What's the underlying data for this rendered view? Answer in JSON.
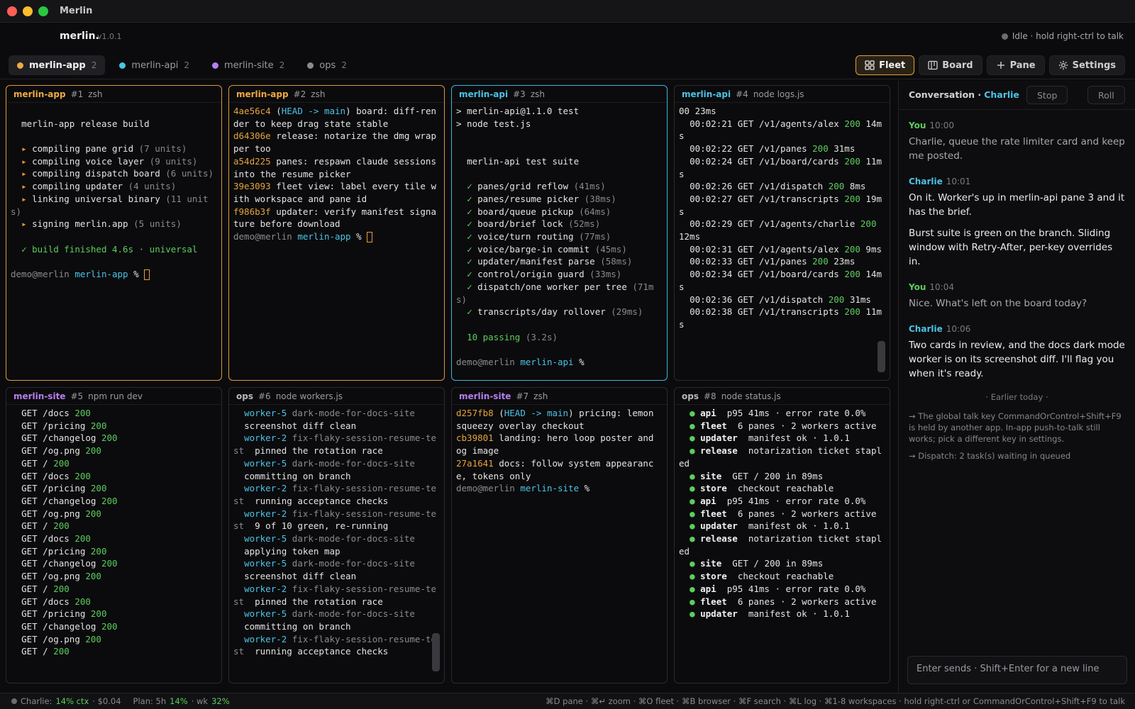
{
  "window": {
    "title": "Merlin"
  },
  "app": {
    "name": "merlin.",
    "version": "v1.0.1",
    "status": "Idle · hold right-ctrl to talk"
  },
  "workspaces": [
    {
      "label": "merlin-app",
      "count": "2",
      "color": "#f0a944"
    },
    {
      "label": "merlin-api",
      "count": "2",
      "color": "#4cc3e6"
    },
    {
      "label": "merlin-site",
      "count": "2",
      "color": "#b67ff0"
    },
    {
      "label": "ops",
      "count": "2",
      "color": "#8a8a8f"
    }
  ],
  "views": {
    "fleet": "Fleet",
    "board": "Board",
    "pane": "Pane",
    "settings": "Settings"
  },
  "panes": [
    {
      "workspace": "merlin-app",
      "num": "#1",
      "cmd": "zsh"
    },
    {
      "workspace": "merlin-app",
      "num": "#2",
      "cmd": "zsh"
    },
    {
      "workspace": "merlin-api",
      "num": "#3",
      "cmd": "zsh"
    },
    {
      "workspace": "merlin-api",
      "num": "#4",
      "cmd": "node logs.js"
    },
    {
      "workspace": "merlin-site",
      "num": "#5",
      "cmd": "npm run dev"
    },
    {
      "workspace": "ops",
      "num": "#6",
      "cmd": "node workers.js"
    },
    {
      "workspace": "merlin-site",
      "num": "#7",
      "cmd": "zsh"
    },
    {
      "workspace": "ops",
      "num": "#8",
      "cmd": "node status.js"
    }
  ],
  "terminals": {
    "p1": [
      [],
      [
        [
          "  merlin-app release build",
          ""
        ]
      ],
      [],
      [
        [
          "  ▸ ",
          "org"
        ],
        [
          "compiling pane grid ",
          ""
        ],
        [
          "(7 units)",
          "dim"
        ]
      ],
      [
        [
          "  ▸ ",
          "org"
        ],
        [
          "compiling voice layer ",
          ""
        ],
        [
          "(9 units)",
          "dim"
        ]
      ],
      [
        [
          "  ▸ ",
          "org"
        ],
        [
          "compiling dispatch board ",
          ""
        ],
        [
          "(6 units)",
          "dim"
        ]
      ],
      [
        [
          "  ▸ ",
          "org"
        ],
        [
          "compiling updater ",
          ""
        ],
        [
          "(4 units)",
          "dim"
        ]
      ],
      [
        [
          "  ▸ ",
          "org"
        ],
        [
          "linking universal binary ",
          ""
        ],
        [
          "(11 units)",
          "dim"
        ]
      ],
      [
        [
          "  ▸ ",
          "org"
        ],
        [
          "signing merlin.app ",
          ""
        ],
        [
          "(5 units)",
          "dim"
        ]
      ],
      [],
      [
        [
          "  ✓ build finished 4.6s · universal",
          "grn"
        ]
      ],
      [],
      [
        [
          "demo@merlin ",
          "dim"
        ],
        [
          "merlin-app",
          "cyn"
        ],
        [
          " % ",
          ""
        ],
        [
          "",
          "cursor"
        ]
      ]
    ],
    "p2": [
      [
        [
          "4ae56c4",
          "ylw"
        ],
        [
          " (",
          ""
        ],
        [
          "HEAD -> main",
          "cyn"
        ],
        [
          ") board: diff-render to keep drag state stable",
          ""
        ]
      ],
      [
        [
          "d64306e",
          "ylw"
        ],
        [
          " release: notarize the dmg wrapper too",
          ""
        ]
      ],
      [
        [
          "a54d225",
          "ylw"
        ],
        [
          " panes: respawn claude sessions into the resume picker",
          ""
        ]
      ],
      [
        [
          "39e3093",
          "ylw"
        ],
        [
          " fleet view: label every tile with workspace and pane id",
          ""
        ]
      ],
      [
        [
          "f986b3f",
          "ylw"
        ],
        [
          " updater: verify manifest signature before download",
          ""
        ]
      ],
      [
        [
          "demo@merlin ",
          "dim"
        ],
        [
          "merlin-app",
          "cyn"
        ],
        [
          " % ",
          ""
        ],
        [
          "",
          "cursor"
        ]
      ]
    ],
    "p3": [
      [
        [
          "> merlin-api@1.1.0 test",
          ""
        ]
      ],
      [
        [
          "> node test.js",
          ""
        ]
      ],
      [],
      [],
      [
        [
          "  merlin-api test suite",
          ""
        ]
      ],
      [],
      [
        [
          "  ✓ ",
          "grn"
        ],
        [
          "panes/grid reflow ",
          ""
        ],
        [
          "(41ms)",
          "dim"
        ]
      ],
      [
        [
          "  ✓ ",
          "grn"
        ],
        [
          "panes/resume picker ",
          ""
        ],
        [
          "(38ms)",
          "dim"
        ]
      ],
      [
        [
          "  ✓ ",
          "grn"
        ],
        [
          "board/queue pickup ",
          ""
        ],
        [
          "(64ms)",
          "dim"
        ]
      ],
      [
        [
          "  ✓ ",
          "grn"
        ],
        [
          "board/brief lock ",
          ""
        ],
        [
          "(52ms)",
          "dim"
        ]
      ],
      [
        [
          "  ✓ ",
          "grn"
        ],
        [
          "voice/turn routing ",
          ""
        ],
        [
          "(77ms)",
          "dim"
        ]
      ],
      [
        [
          "  ✓ ",
          "grn"
        ],
        [
          "voice/barge-in commit ",
          ""
        ],
        [
          "(45ms)",
          "dim"
        ]
      ],
      [
        [
          "  ✓ ",
          "grn"
        ],
        [
          "updater/manifest parse ",
          ""
        ],
        [
          "(58ms)",
          "dim"
        ]
      ],
      [
        [
          "  ✓ ",
          "grn"
        ],
        [
          "control/origin guard ",
          ""
        ],
        [
          "(33ms)",
          "dim"
        ]
      ],
      [
        [
          "  ✓ ",
          "grn"
        ],
        [
          "dispatch/one worker per tree ",
          ""
        ],
        [
          "(71ms)",
          "dim"
        ]
      ],
      [
        [
          "  ✓ ",
          "grn"
        ],
        [
          "transcripts/day rollover ",
          ""
        ],
        [
          "(29ms)",
          "dim"
        ]
      ],
      [],
      [
        [
          "  10 passing ",
          "grn"
        ],
        [
          "(3.2s)",
          "dim"
        ]
      ],
      [],
      [
        [
          "demo@merlin ",
          "dim"
        ],
        [
          "merlin-api",
          "cyn"
        ],
        [
          " %",
          ""
        ]
      ]
    ],
    "p4": [
      [
        [
          "00 23ms",
          ""
        ]
      ],
      [
        [
          "  00:02:21 GET /v1/agents/alex ",
          ""
        ],
        [
          "200",
          "grn"
        ],
        [
          " 14ms",
          ""
        ]
      ],
      [
        [
          "  00:02:22 GET /v1/panes ",
          ""
        ],
        [
          "200",
          "grn"
        ],
        [
          " 31ms",
          ""
        ]
      ],
      [
        [
          "  00:02:24 GET /v1/board/cards ",
          ""
        ],
        [
          "200",
          "grn"
        ],
        [
          " 11ms",
          ""
        ]
      ],
      [
        [
          "  00:02:26 GET /v1/dispatch ",
          ""
        ],
        [
          "200",
          "grn"
        ],
        [
          " 8ms",
          ""
        ]
      ],
      [
        [
          "  00:02:27 GET /v1/transcripts ",
          ""
        ],
        [
          "200",
          "grn"
        ],
        [
          " 19ms",
          ""
        ]
      ],
      [
        [
          "  00:02:29 GET /v1/agents/charlie ",
          ""
        ],
        [
          "200",
          "grn"
        ],
        [
          " 12ms",
          ""
        ]
      ],
      [
        [
          "  00:02:31 GET /v1/agents/alex ",
          ""
        ],
        [
          "200",
          "grn"
        ],
        [
          " 9ms",
          ""
        ]
      ],
      [
        [
          "  00:02:33 GET /v1/panes ",
          ""
        ],
        [
          "200",
          "grn"
        ],
        [
          " 23ms",
          ""
        ]
      ],
      [
        [
          "  00:02:34 GET /v1/board/cards ",
          ""
        ],
        [
          "200",
          "grn"
        ],
        [
          " 14ms",
          ""
        ]
      ],
      [
        [
          "  00:02:36 GET /v1/dispatch ",
          ""
        ],
        [
          "200",
          "grn"
        ],
        [
          " 31ms",
          ""
        ]
      ],
      [
        [
          "  00:02:38 GET /v1/transcripts ",
          ""
        ],
        [
          "200",
          "grn"
        ],
        [
          " 11ms",
          ""
        ]
      ]
    ],
    "p5": [
      [
        [
          "  GET /docs ",
          ""
        ],
        [
          "200",
          "grn"
        ]
      ],
      [
        [
          "  GET /pricing ",
          ""
        ],
        [
          "200",
          "grn"
        ]
      ],
      [
        [
          "  GET /changelog ",
          ""
        ],
        [
          "200",
          "grn"
        ]
      ],
      [
        [
          "  GET /og.png ",
          ""
        ],
        [
          "200",
          "grn"
        ]
      ],
      [
        [
          "  GET / ",
          ""
        ],
        [
          "200",
          "grn"
        ]
      ],
      [
        [
          "  GET /docs ",
          ""
        ],
        [
          "200",
          "grn"
        ]
      ],
      [
        [
          "  GET /pricing ",
          ""
        ],
        [
          "200",
          "grn"
        ]
      ],
      [
        [
          "  GET /changelog ",
          ""
        ],
        [
          "200",
          "grn"
        ]
      ],
      [
        [
          "  GET /og.png ",
          ""
        ],
        [
          "200",
          "grn"
        ]
      ],
      [
        [
          "  GET / ",
          ""
        ],
        [
          "200",
          "grn"
        ]
      ],
      [
        [
          "  GET /docs ",
          ""
        ],
        [
          "200",
          "grn"
        ]
      ],
      [
        [
          "  GET /pricing ",
          ""
        ],
        [
          "200",
          "grn"
        ]
      ],
      [
        [
          "  GET /changelog ",
          ""
        ],
        [
          "200",
          "grn"
        ]
      ],
      [
        [
          "  GET /og.png ",
          ""
        ],
        [
          "200",
          "grn"
        ]
      ],
      [
        [
          "  GET / ",
          ""
        ],
        [
          "200",
          "grn"
        ]
      ],
      [
        [
          "  GET /docs ",
          ""
        ],
        [
          "200",
          "grn"
        ]
      ],
      [
        [
          "  GET /pricing ",
          ""
        ],
        [
          "200",
          "grn"
        ]
      ],
      [
        [
          "  GET /changelog ",
          ""
        ],
        [
          "200",
          "grn"
        ]
      ],
      [
        [
          "  GET /og.png ",
          ""
        ],
        [
          "200",
          "grn"
        ]
      ],
      [
        [
          "  GET / ",
          ""
        ],
        [
          "200",
          "grn"
        ]
      ]
    ],
    "p6": [
      [
        [
          "  worker-5",
          "cyn"
        ],
        [
          " dark-mode-for-docs-site",
          "dim"
        ]
      ],
      [
        [
          "  screenshot diff clean",
          ""
        ]
      ],
      [
        [
          "  worker-2",
          "cyn"
        ],
        [
          " fix-flaky-session-resume-test",
          "dim"
        ],
        [
          "  pinned the rotation race",
          ""
        ]
      ],
      [
        [
          "  worker-5",
          "cyn"
        ],
        [
          " dark-mode-for-docs-site",
          "dim"
        ]
      ],
      [
        [
          "  committing on branch",
          ""
        ]
      ],
      [
        [
          "  worker-2",
          "cyn"
        ],
        [
          " fix-flaky-session-resume-test",
          "dim"
        ],
        [
          "  running acceptance checks",
          ""
        ]
      ],
      [
        [
          "  worker-2",
          "cyn"
        ],
        [
          " fix-flaky-session-resume-test",
          "dim"
        ],
        [
          "  9 of 10 green, re-running",
          ""
        ]
      ],
      [
        [
          "  worker-5",
          "cyn"
        ],
        [
          " dark-mode-for-docs-site",
          "dim"
        ]
      ],
      [
        [
          "  applying token map",
          ""
        ]
      ],
      [
        [
          "  worker-5",
          "cyn"
        ],
        [
          " dark-mode-for-docs-site",
          "dim"
        ]
      ],
      [
        [
          "  screenshot diff clean",
          ""
        ]
      ],
      [
        [
          "  worker-2",
          "cyn"
        ],
        [
          " fix-flaky-session-resume-test",
          "dim"
        ],
        [
          "  pinned the rotation race",
          ""
        ]
      ],
      [
        [
          "  worker-5",
          "cyn"
        ],
        [
          " dark-mode-for-docs-site",
          "dim"
        ]
      ],
      [
        [
          "  committing on branch",
          ""
        ]
      ],
      [
        [
          "  worker-2",
          "cyn"
        ],
        [
          " fix-flaky-session-resume-test",
          "dim"
        ],
        [
          "  running acceptance checks",
          ""
        ]
      ]
    ],
    "p7": [
      [
        [
          "d257fb8",
          "ylw"
        ],
        [
          " (",
          ""
        ],
        [
          "HEAD -> main",
          "cyn"
        ],
        [
          ") pricing: lemon squeezy overlay checkout",
          ""
        ]
      ],
      [
        [
          "cb39801",
          "ylw"
        ],
        [
          " landing: hero loop poster and og image",
          ""
        ]
      ],
      [
        [
          "27a1641",
          "ylw"
        ],
        [
          " docs: follow system appearance, tokens only",
          ""
        ]
      ],
      [
        [
          "demo@merlin ",
          "dim"
        ],
        [
          "merlin-site",
          "cyn"
        ],
        [
          " %",
          ""
        ]
      ]
    ],
    "p8": [
      [
        [
          "  ● ",
          "grn"
        ],
        [
          "api",
          "wht"
        ],
        [
          "  p95 41ms · error rate 0.0%",
          ""
        ]
      ],
      [
        [
          "  ● ",
          "grn"
        ],
        [
          "fleet",
          "wht"
        ],
        [
          "  6 panes · 2 workers active",
          ""
        ]
      ],
      [
        [
          "  ● ",
          "grn"
        ],
        [
          "updater",
          "wht"
        ],
        [
          "  manifest ok · 1.0.1",
          ""
        ]
      ],
      [
        [
          "  ● ",
          "grn"
        ],
        [
          "release",
          "wht"
        ],
        [
          "  notarization ticket stapled",
          ""
        ]
      ],
      [
        [
          "  ● ",
          "grn"
        ],
        [
          "site",
          "wht"
        ],
        [
          "  GET / 200 in 89ms",
          ""
        ]
      ],
      [
        [
          "  ● ",
          "grn"
        ],
        [
          "store",
          "wht"
        ],
        [
          "  checkout reachable",
          ""
        ]
      ],
      [
        [
          "  ● ",
          "grn"
        ],
        [
          "api",
          "wht"
        ],
        [
          "  p95 41ms · error rate 0.0%",
          ""
        ]
      ],
      [
        [
          "  ● ",
          "grn"
        ],
        [
          "fleet",
          "wht"
        ],
        [
          "  6 panes · 2 workers active",
          ""
        ]
      ],
      [
        [
          "  ● ",
          "grn"
        ],
        [
          "updater",
          "wht"
        ],
        [
          "  manifest ok · 1.0.1",
          ""
        ]
      ],
      [
        [
          "  ● ",
          "grn"
        ],
        [
          "release",
          "wht"
        ],
        [
          "  notarization ticket stapled",
          ""
        ]
      ],
      [
        [
          "  ● ",
          "grn"
        ],
        [
          "site",
          "wht"
        ],
        [
          "  GET / 200 in 89ms",
          ""
        ]
      ],
      [
        [
          "  ● ",
          "grn"
        ],
        [
          "store",
          "wht"
        ],
        [
          "  checkout reachable",
          ""
        ]
      ],
      [
        [
          "  ● ",
          "grn"
        ],
        [
          "api",
          "wht"
        ],
        [
          "  p95 41ms · error rate 0.0%",
          ""
        ]
      ],
      [
        [
          "  ● ",
          "grn"
        ],
        [
          "fleet",
          "wht"
        ],
        [
          "  6 panes · 2 workers active",
          ""
        ]
      ],
      [
        [
          "  ● ",
          "grn"
        ],
        [
          "updater",
          "wht"
        ],
        [
          "  manifest ok · 1.0.1",
          ""
        ]
      ]
    ]
  },
  "conversation": {
    "title": "Conversation ·",
    "agent": "Charlie",
    "stop": "Stop",
    "roll": "Roll",
    "messages": [
      {
        "who": "You",
        "time": "10:00",
        "paragraphs": [
          "Charlie, queue the rate limiter card and keep me posted."
        ]
      },
      {
        "who": "Charlie",
        "time": "10:01",
        "paragraphs": [
          "On it. Worker's up in merlin-api pane 3 and it has the brief.",
          "Burst suite is green on the branch. Sliding window with Retry-After, per-key overrides in."
        ]
      },
      {
        "who": "You",
        "time": "10:04",
        "paragraphs": [
          "Nice. What's left on the board today?"
        ]
      },
      {
        "who": "Charlie",
        "time": "10:06",
        "paragraphs": [
          "Two cards in review, and the docs dark mode worker is on its screenshot diff. I'll flag you when it's ready."
        ]
      }
    ],
    "earlier": "· Earlier today ·",
    "notes": [
      "→ The global talk key CommandOrControl+Shift+F9 is held by another app. In-app push-to-talk still works; pick a different key in settings.",
      "→ Dispatch: 2 task(s) waiting in queued"
    ],
    "input_placeholder": "Enter sends · Shift+Enter for a new line"
  },
  "statusbar": {
    "agent": "Charlie:",
    "ctx": "14% ctx",
    "cost": "· $0.04",
    "plan_label": "Plan: 5h",
    "plan_5h": "14%",
    "wk_label": "· wk",
    "plan_wk": "32%",
    "shortcuts": "⌘D pane · ⌘↵ zoom · ⌘O fleet · ⌘B browser · ⌘F search · ⌘L log · ⌘1-8 workspaces · hold right-ctrl or CommandOrControl+Shift+F9 to talk"
  }
}
